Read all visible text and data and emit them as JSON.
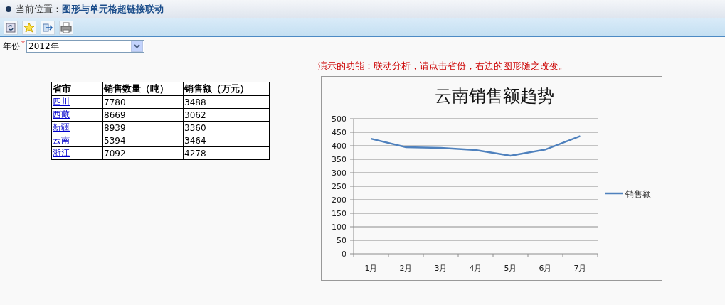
{
  "breadcrumb": {
    "label": "当前位置：",
    "current": "图形与单元格超链接联动"
  },
  "toolbar": {
    "buttons": [
      {
        "kind": "refresh"
      },
      {
        "kind": "favorite"
      },
      {
        "kind": "export"
      },
      {
        "kind": "print"
      }
    ]
  },
  "filter": {
    "label": "年份",
    "required_mark": "*",
    "value": "2012年"
  },
  "note": "演示的功能：联动分析，请点击省份，右边的图形随之改变。",
  "table": {
    "columns": [
      "省市",
      "销售数量（吨）",
      "销售额（万元）"
    ],
    "rows": [
      [
        "四川",
        "7780",
        "3488"
      ],
      [
        "西藏",
        "8669",
        "3062"
      ],
      [
        "新疆",
        "8939",
        "3360"
      ],
      [
        "云南",
        "5394",
        "3464"
      ],
      [
        "浙江",
        "7092",
        "4278"
      ]
    ]
  },
  "chart": {
    "chart_data": {
      "type": "line",
      "title": "云南销售额趋势",
      "categories": [
        "1月",
        "2月",
        "3月",
        "4月",
        "5月",
        "6月",
        "7月"
      ],
      "series": [
        {
          "name": "销售额",
          "color": "#4f81bd",
          "values": [
            426,
            395,
            392,
            384,
            363,
            386,
            436
          ]
        }
      ],
      "grid": true,
      "ylim": [
        0,
        500
      ],
      "yticks": [
        0,
        50,
        100,
        150,
        200,
        250,
        300,
        350,
        400,
        450,
        500
      ]
    }
  }
}
